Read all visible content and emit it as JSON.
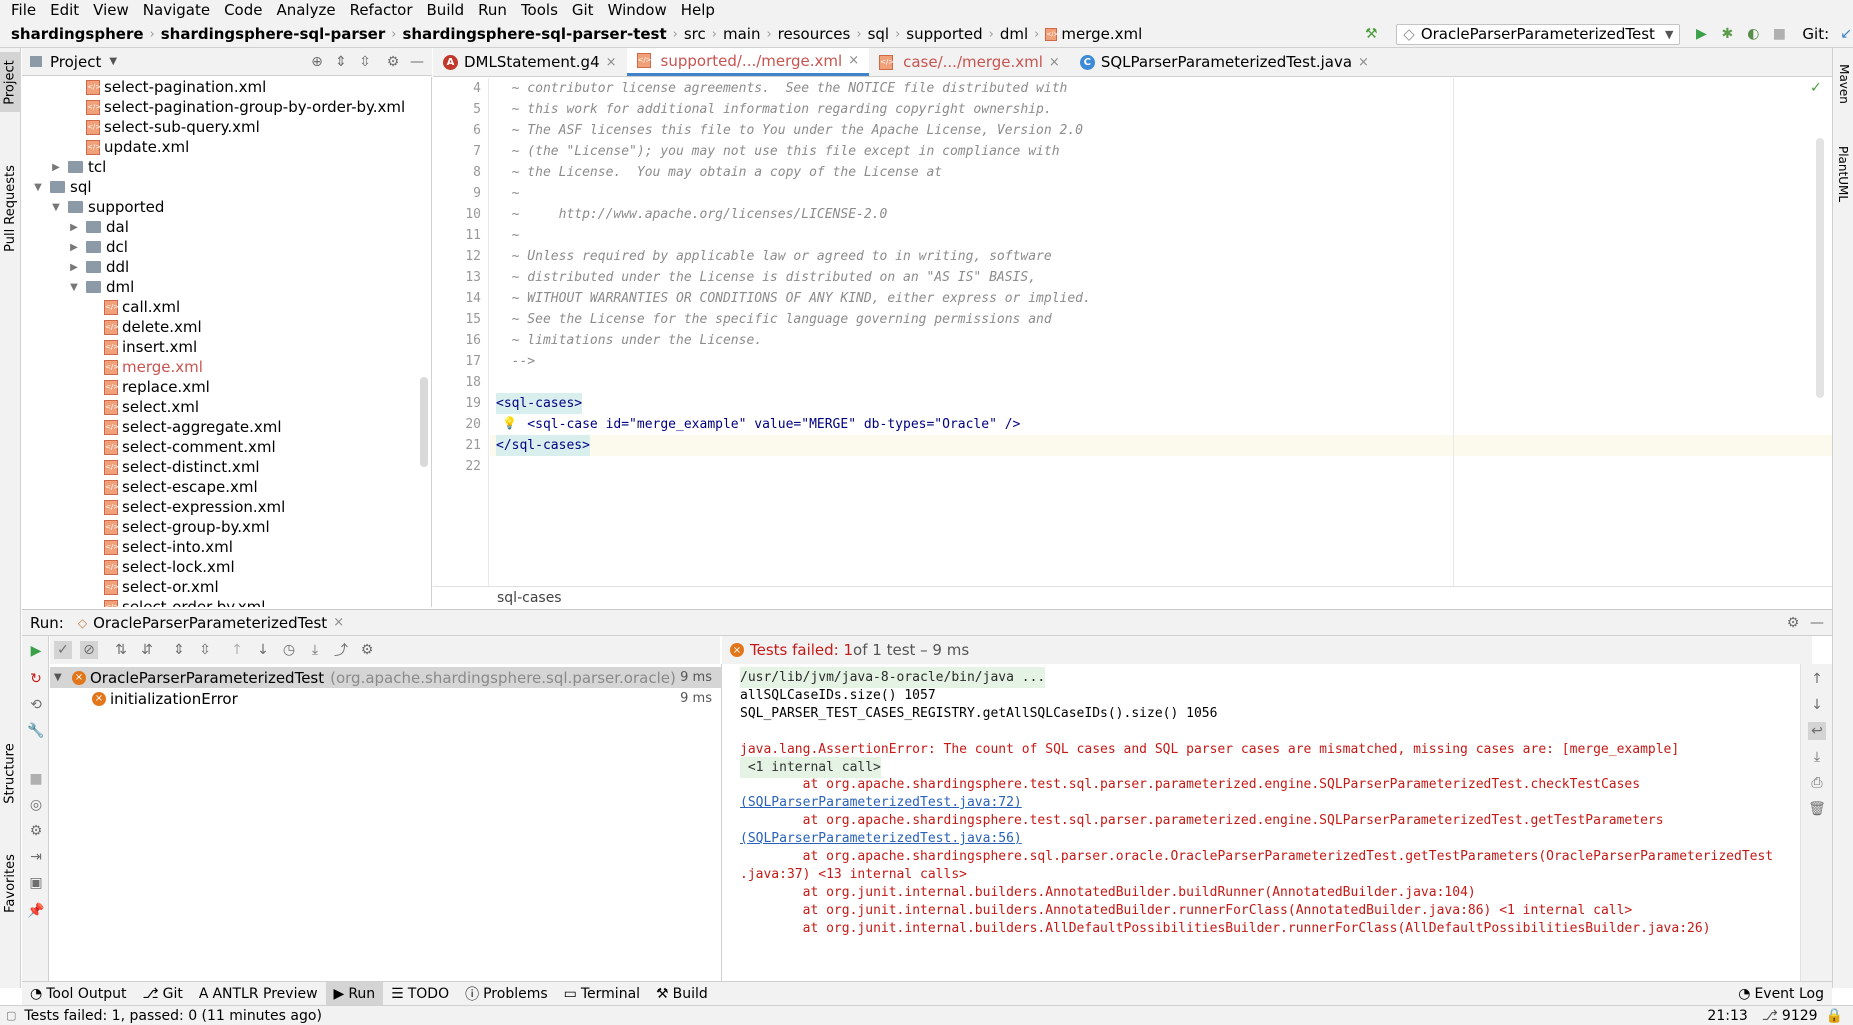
{
  "menu": [
    "File",
    "Edit",
    "View",
    "Navigate",
    "Code",
    "Analyze",
    "Refactor",
    "Build",
    "Run",
    "Tools",
    "Git",
    "Window",
    "Help"
  ],
  "breadcrumbs": [
    "shardingsphere",
    "shardingsphere-sql-parser",
    "shardingsphere-sql-parser-test",
    "src",
    "main",
    "resources",
    "sql",
    "supported",
    "dml",
    "merge.xml"
  ],
  "run_config": "OracleParserParameterizedTest",
  "git_label": "Git:",
  "project_panel": {
    "title": "Project"
  },
  "tree": [
    {
      "label": "select-pagination.xml",
      "depth": 4,
      "kind": "xml"
    },
    {
      "label": "select-pagination-group-by-order-by.xml",
      "depth": 4,
      "kind": "xml"
    },
    {
      "label": "select-sub-query.xml",
      "depth": 4,
      "kind": "xml"
    },
    {
      "label": "update.xml",
      "depth": 4,
      "kind": "xml"
    },
    {
      "label": "tcl",
      "depth": 3,
      "kind": "folder",
      "expanded": false
    },
    {
      "label": "sql",
      "depth": 2,
      "kind": "folder",
      "expanded": true
    },
    {
      "label": "supported",
      "depth": 3,
      "kind": "folder",
      "expanded": true
    },
    {
      "label": "dal",
      "depth": 4,
      "kind": "folder",
      "expanded": false
    },
    {
      "label": "dcl",
      "depth": 4,
      "kind": "folder",
      "expanded": false
    },
    {
      "label": "ddl",
      "depth": 4,
      "kind": "folder",
      "expanded": false
    },
    {
      "label": "dml",
      "depth": 4,
      "kind": "folder",
      "expanded": true
    },
    {
      "label": "call.xml",
      "depth": 5,
      "kind": "xml"
    },
    {
      "label": "delete.xml",
      "depth": 5,
      "kind": "xml"
    },
    {
      "label": "insert.xml",
      "depth": 5,
      "kind": "xml"
    },
    {
      "label": "merge.xml",
      "depth": 5,
      "kind": "xml",
      "highlight": true
    },
    {
      "label": "replace.xml",
      "depth": 5,
      "kind": "xml"
    },
    {
      "label": "select.xml",
      "depth": 5,
      "kind": "xml"
    },
    {
      "label": "select-aggregate.xml",
      "depth": 5,
      "kind": "xml"
    },
    {
      "label": "select-comment.xml",
      "depth": 5,
      "kind": "xml"
    },
    {
      "label": "select-distinct.xml",
      "depth": 5,
      "kind": "xml"
    },
    {
      "label": "select-escape.xml",
      "depth": 5,
      "kind": "xml"
    },
    {
      "label": "select-expression.xml",
      "depth": 5,
      "kind": "xml"
    },
    {
      "label": "select-group-by.xml",
      "depth": 5,
      "kind": "xml"
    },
    {
      "label": "select-into.xml",
      "depth": 5,
      "kind": "xml"
    },
    {
      "label": "select-lock.xml",
      "depth": 5,
      "kind": "xml"
    },
    {
      "label": "select-or.xml",
      "depth": 5,
      "kind": "xml"
    },
    {
      "label": "select-order-by.xml",
      "depth": 5,
      "kind": "xml"
    }
  ],
  "editor_tabs": [
    {
      "label": "DMLStatement.g4",
      "active": false
    },
    {
      "label": "supported/.../merge.xml",
      "active": true
    },
    {
      "label": "case/.../merge.xml",
      "active": false
    },
    {
      "label": "SQLParserParameterizedTest.java",
      "active": false
    }
  ],
  "code_lines": [
    {
      "n": "4",
      "text": "  ~ contributor license agreements.  See the NOTICE file distributed with",
      "kind": "comment"
    },
    {
      "n": "5",
      "text": "  ~ this work for additional information regarding copyright ownership.",
      "kind": "comment"
    },
    {
      "n": "6",
      "text": "  ~ The ASF licenses this file to You under the Apache License, Version 2.0",
      "kind": "comment"
    },
    {
      "n": "7",
      "text": "  ~ (the \"License\"); you may not use this file except in compliance with",
      "kind": "comment"
    },
    {
      "n": "8",
      "text": "  ~ the License.  You may obtain a copy of the License at",
      "kind": "comment"
    },
    {
      "n": "9",
      "text": "  ~",
      "kind": "comment"
    },
    {
      "n": "10",
      "text": "  ~     http://www.apache.org/licenses/LICENSE-2.0",
      "kind": "url"
    },
    {
      "n": "11",
      "text": "  ~",
      "kind": "comment"
    },
    {
      "n": "12",
      "text": "  ~ Unless required by applicable law or agreed to in writing, software",
      "kind": "comment"
    },
    {
      "n": "13",
      "text": "  ~ distributed under the License is distributed on an \"AS IS\" BASIS,",
      "kind": "comment"
    },
    {
      "n": "14",
      "text": "  ~ WITHOUT WARRANTIES OR CONDITIONS OF ANY KIND, either express or implied.",
      "kind": "comment"
    },
    {
      "n": "15",
      "text": "  ~ See the License for the specific language governing permissions and",
      "kind": "comment"
    },
    {
      "n": "16",
      "text": "  ~ limitations under the License.",
      "kind": "comment"
    },
    {
      "n": "17",
      "text": "  -->",
      "kind": "comment"
    },
    {
      "n": "18",
      "text": "",
      "kind": "blank"
    },
    {
      "n": "19",
      "text": "<sql-cases>",
      "kind": "tag"
    },
    {
      "n": "20",
      "text": "    <sql-case id=\"merge_example\" value=\"MERGE\" db-types=\"Oracle\" />",
      "kind": "tag"
    },
    {
      "n": "21",
      "text": "</sql-cases>",
      "kind": "tag",
      "current": true
    },
    {
      "n": "22",
      "text": "",
      "kind": "blank"
    }
  ],
  "code_breadcrumb": "sql-cases",
  "run_panel": {
    "label": "Run:",
    "tab": "OracleParserParameterizedTest"
  },
  "test_status": {
    "failed": "Tests failed: 1",
    "rest": " of 1 test – 9 ms"
  },
  "tests": [
    {
      "name": "OracleParserParameterizedTest",
      "pkg": "(org.apache.shardingsphere.sql.parser.oracle)",
      "time": "9 ms"
    },
    {
      "name": "initializationError",
      "pkg": "",
      "time": "9 ms"
    }
  ],
  "console": [
    {
      "text": "/usr/lib/jvm/java-8-oracle/bin/java ...",
      "kind": "cmd"
    },
    {
      "text": "allSQLCaseIDs.size() 1057",
      "kind": "out"
    },
    {
      "text": "SQL_PARSER_TEST_CASES_REGISTRY.getAllSQLCaseIDs().size() 1056",
      "kind": "out"
    },
    {
      "text": "",
      "kind": "out"
    },
    {
      "text": "java.lang.AssertionError: The count of SQL cases and SQL parser cases are mismatched, missing cases are: [merge_example]",
      "kind": "err"
    },
    {
      "text": " <1 internal call>",
      "kind": "fold"
    },
    {
      "text": "\tat org.apache.shardingsphere.test.sql.parser.parameterized.engine.SQLParserParameterizedTest.checkTestCases",
      "kind": "err"
    },
    {
      "text": "(SQLParserParameterizedTest.java:72)",
      "kind": "errlink"
    },
    {
      "text": "\tat org.apache.shardingsphere.test.sql.parser.parameterized.engine.SQLParserParameterizedTest.getTestParameters",
      "kind": "err"
    },
    {
      "text": "(SQLParserParameterizedTest.java:56)",
      "kind": "errlink"
    },
    {
      "text": "\tat org.apache.shardingsphere.sql.parser.oracle.OracleParserParameterizedTest.getTestParameters(OracleParserParameterizedTest",
      "kind": "err"
    },
    {
      "text": ".java:37) <13 internal calls>",
      "kind": "err"
    },
    {
      "text": "\tat org.junit.internal.builders.AnnotatedBuilder.buildRunner(AnnotatedBuilder.java:104)",
      "kind": "err"
    },
    {
      "text": "\tat org.junit.internal.builders.AnnotatedBuilder.runnerForClass(AnnotatedBuilder.java:86) <1 internal call>",
      "kind": "err"
    },
    {
      "text": "\tat org.junit.internal.builders.AllDefaultPossibilitiesBuilder.runnerForClass(AllDefaultPossibilitiesBuilder.java:26)",
      "kind": "err"
    }
  ],
  "tool_windows": [
    "Tool Output",
    "Git",
    "ANTLR Preview",
    "Run",
    "TODO",
    "Problems",
    "Terminal",
    "Build"
  ],
  "event_log": "Event Log",
  "left_stripe": [
    "Project",
    "Pull Requests",
    "Structure",
    "Favorites"
  ],
  "right_stripe": [
    "Maven",
    "PlantUML"
  ],
  "status": {
    "message": "Tests failed: 1, passed: 0 (11 minutes ago)",
    "position": "21:13",
    "extra": "9129"
  },
  "colors": {
    "accent": "#4083c9",
    "error": "#c41a16",
    "link": "#2a62b9",
    "highlight_file": "#c75450"
  }
}
